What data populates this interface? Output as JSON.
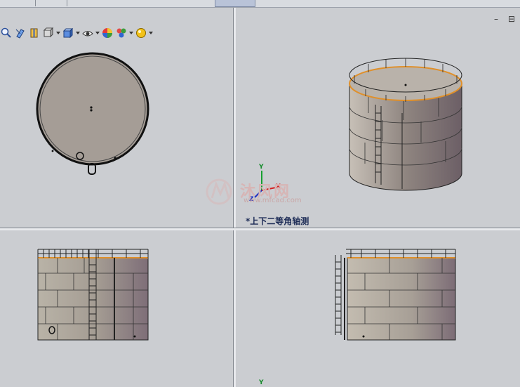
{
  "window": {
    "minimize_glyph": "–",
    "restore_glyph": "⊟"
  },
  "toolbar": {
    "items": [
      {
        "name": "zoom-to-area-icon"
      },
      {
        "name": "previous-view-icon"
      },
      {
        "name": "section-view-icon"
      },
      {
        "name": "view-orientation-icon"
      },
      {
        "name": "display-style-icon"
      },
      {
        "name": "hide-show-items-icon"
      },
      {
        "name": "edit-appearance-icon"
      },
      {
        "name": "apply-scene-icon"
      },
      {
        "name": "view-settings-icon"
      }
    ]
  },
  "viewports": {
    "top_right": {
      "view_label": "*上下二等角轴测"
    },
    "triad_y_label": "Y",
    "triad_x_label": "X",
    "triad_z_label": "Z",
    "bottom_right_y_label": "Y"
  },
  "watermark": {
    "text": "沐风网",
    "url": "www.mfcad.com"
  },
  "colors": {
    "viewport_bg": "#cbcdd1",
    "tank_body": "#a59d96",
    "tank_top": "#b9b2aa",
    "railing_accent": "#e0902a",
    "triad_x": "#d42020",
    "triad_y": "#18a030",
    "triad_z": "#2030c0"
  }
}
